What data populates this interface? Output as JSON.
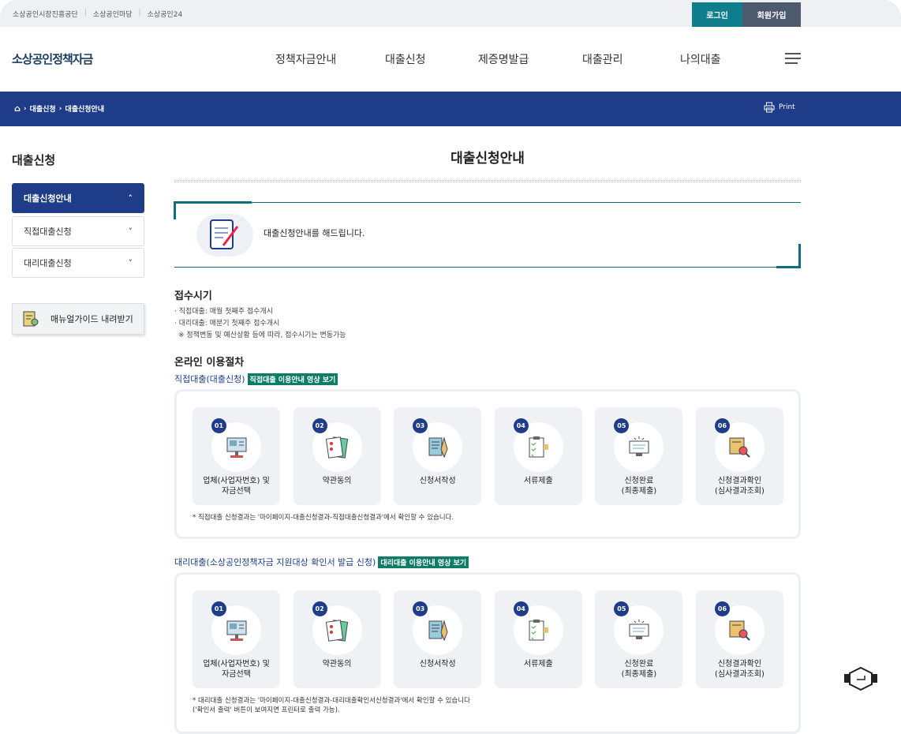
{
  "topbar": {
    "links": [
      "소상공인시장진흥공단",
      "소상공인마당",
      "소상공인24"
    ],
    "login": "로그인",
    "join": "회원가입"
  },
  "header": {
    "logo": "소상공인정책자금",
    "nav": [
      "정책자금안내",
      "대출신청",
      "제증명발급",
      "대출관리",
      "나의대출"
    ]
  },
  "breadcrumb": {
    "items": [
      "대출신청",
      "대출신청안내"
    ],
    "print": "Print"
  },
  "sidebar": {
    "title": "대출신청",
    "items": [
      "대출신청안내",
      "직접대출신청",
      "대리대출신청"
    ],
    "manual": "매뉴얼가이드 내려받기"
  },
  "main": {
    "title": "대출신청안내",
    "intro": "대출신청안내를 해드립니다.",
    "period": {
      "title": "접수시기",
      "lines": [
        "· 직접대출: 매월 첫째주 접수개시",
        "· 대리대출: 매분기 첫째주 접수개시",
        "※ 정책변동 및 예산상황 등에 따라, 접수시기는 변동가능"
      ]
    },
    "procedure": {
      "title": "온라인 이용절차",
      "direct": {
        "label": "직접대출(대출신청)",
        "video": "직접대출 이용안내 영상 보기",
        "note": "* 직접대출 신청결과는 '마이페이지-대출신청결과-직접대출신청결과'에서 확인할 수 있습니다."
      },
      "agent": {
        "label": "대리대출(소상공인정책자금 지원대상 확인서 발급 신청)",
        "video": "대리대출 이용안내 영상 보기",
        "note1": "* 대리대출 신청결과는 '마이페이지-대출신청결과-대리대출확인서신청결과'에서 확인할 수 있습니다",
        "note2": "('확인서 출력' 버튼이 보여지면 프린터로 출력 가능)."
      },
      "steps": [
        {
          "num": "01",
          "label": "업체(사업자번호) 및\n자금선택"
        },
        {
          "num": "02",
          "label": "약관동의"
        },
        {
          "num": "03",
          "label": "신청서작성"
        },
        {
          "num": "04",
          "label": "서류제출"
        },
        {
          "num": "05",
          "label": "신청완료\n(최종제출)"
        },
        {
          "num": "06",
          "label": "신청결과확인\n(심사결과조회)"
        }
      ]
    }
  }
}
